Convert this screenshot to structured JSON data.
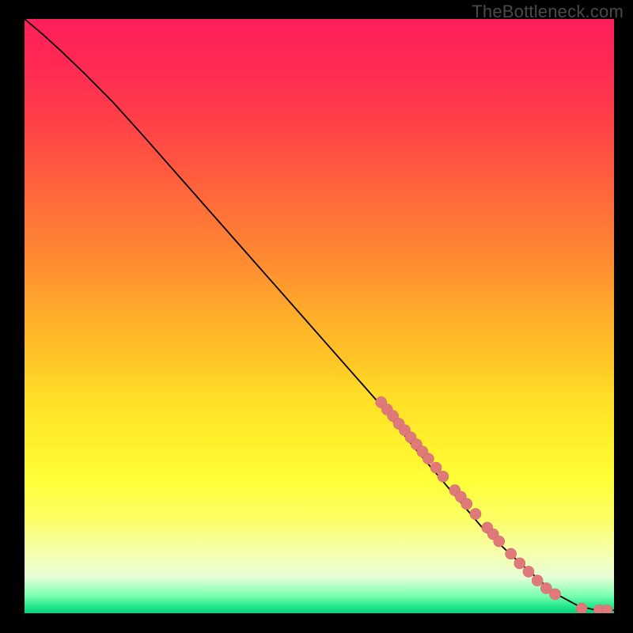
{
  "watermark": "TheBottleneck.com",
  "colors": {
    "dot_fill": "#e07a7a",
    "dot_stroke": "#d06a6a",
    "curve": "#000000",
    "page_bg": "#000000"
  },
  "chart_data": {
    "type": "line",
    "title": "",
    "xlabel": "",
    "ylabel": "",
    "xlim": [
      0,
      100
    ],
    "ylim": [
      0,
      100
    ],
    "grid": false,
    "legend": false,
    "curve": {
      "comment": "x,y points (0-100 each) approximating the black curve",
      "points": [
        [
          0,
          100
        ],
        [
          3,
          97.5
        ],
        [
          6,
          94.8
        ],
        [
          10,
          91
        ],
        [
          15,
          86
        ],
        [
          20,
          80.5
        ],
        [
          28,
          71.5
        ],
        [
          36,
          62.5
        ],
        [
          44,
          53.5
        ],
        [
          52,
          44.5
        ],
        [
          60,
          35.5
        ],
        [
          66,
          28
        ],
        [
          72,
          21
        ],
        [
          78,
          14
        ],
        [
          84,
          8.5
        ],
        [
          88,
          5
        ],
        [
          91,
          2.8
        ],
        [
          94,
          1.2
        ],
        [
          97,
          0.5
        ],
        [
          100,
          0.5
        ]
      ]
    },
    "dots": {
      "comment": "Pinkish marker positions (x,y 0-100) along the lower-right of the curve",
      "radius_px": 7,
      "points": [
        [
          60.5,
          35.5
        ],
        [
          61.5,
          34.3
        ],
        [
          62.5,
          33.2
        ],
        [
          63.5,
          31.9
        ],
        [
          64.5,
          30.8
        ],
        [
          65.5,
          29.6
        ],
        [
          66.5,
          28.4
        ],
        [
          67.5,
          27.2
        ],
        [
          68.5,
          26.0
        ],
        [
          69.8,
          24.5
        ],
        [
          71.0,
          23.0
        ],
        [
          73.0,
          20.7
        ],
        [
          74.0,
          19.6
        ],
        [
          75.0,
          18.4
        ],
        [
          76.5,
          16.7
        ],
        [
          78.5,
          14.4
        ],
        [
          79.5,
          13.3
        ],
        [
          80.5,
          12.1
        ],
        [
          82.5,
          10.0
        ],
        [
          84.0,
          8.4
        ],
        [
          85.5,
          7.0
        ],
        [
          87.0,
          5.5
        ],
        [
          88.5,
          4.2
        ],
        [
          90.0,
          3.2
        ],
        [
          94.5,
          0.8
        ],
        [
          97.5,
          0.5
        ],
        [
          98.8,
          0.5
        ]
      ]
    }
  }
}
